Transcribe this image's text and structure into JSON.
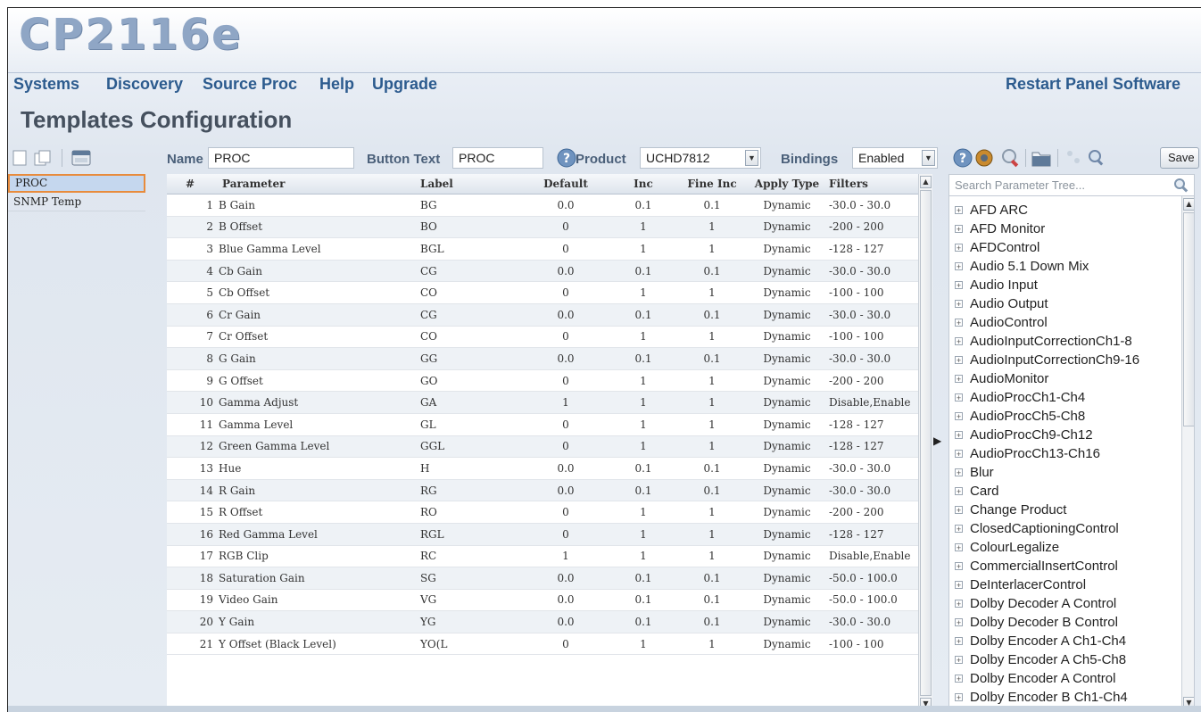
{
  "app": {
    "logo": "CP2116e"
  },
  "nav": {
    "items": [
      "Systems",
      "Discovery",
      "Source Proc",
      "Help",
      "Upgrade"
    ],
    "restart": "Restart Panel Software"
  },
  "page": {
    "title": "Templates Configuration"
  },
  "form": {
    "name_label": "Name",
    "name_value": "PROC",
    "button_text_label": "Button Text",
    "button_text_value": "PROC",
    "product_label": "Product",
    "product_value": "UCHD7812",
    "bindings_label": "Bindings",
    "bindings_value": "Enabled"
  },
  "templates": [
    "PROC",
    "SNMP Temp"
  ],
  "table": {
    "headers": [
      "#",
      "Parameter",
      "Label",
      "Default",
      "Inc",
      "Fine Inc",
      "Apply Type",
      "Filters"
    ],
    "rows": [
      [
        "1",
        "B Gain",
        "BG",
        "0.0",
        "0.1",
        "0.1",
        "Dynamic",
        "-30.0 - 30.0"
      ],
      [
        "2",
        "B Offset",
        "BO",
        "0",
        "1",
        "1",
        "Dynamic",
        "-200 - 200"
      ],
      [
        "3",
        "Blue Gamma Level",
        "BGL",
        "0",
        "1",
        "1",
        "Dynamic",
        "-128 - 127"
      ],
      [
        "4",
        "Cb Gain",
        "CG",
        "0.0",
        "0.1",
        "0.1",
        "Dynamic",
        "-30.0 - 30.0"
      ],
      [
        "5",
        "Cb Offset",
        "CO",
        "0",
        "1",
        "1",
        "Dynamic",
        "-100 - 100"
      ],
      [
        "6",
        "Cr Gain",
        "CG",
        "0.0",
        "0.1",
        "0.1",
        "Dynamic",
        "-30.0 - 30.0"
      ],
      [
        "7",
        "Cr Offset",
        "CO",
        "0",
        "1",
        "1",
        "Dynamic",
        "-100 - 100"
      ],
      [
        "8",
        "G Gain",
        "GG",
        "0.0",
        "0.1",
        "0.1",
        "Dynamic",
        "-30.0 - 30.0"
      ],
      [
        "9",
        "G Offset",
        "GO",
        "0",
        "1",
        "1",
        "Dynamic",
        "-200 - 200"
      ],
      [
        "10",
        "Gamma Adjust",
        "GA",
        "1",
        "1",
        "1",
        "Dynamic",
        "Disable,Enable"
      ],
      [
        "11",
        "Gamma Level",
        "GL",
        "0",
        "1",
        "1",
        "Dynamic",
        "-128 - 127"
      ],
      [
        "12",
        "Green Gamma Level",
        "GGL",
        "0",
        "1",
        "1",
        "Dynamic",
        "-128 - 127"
      ],
      [
        "13",
        "Hue",
        "H",
        "0.0",
        "0.1",
        "0.1",
        "Dynamic",
        "-30.0 - 30.0"
      ],
      [
        "14",
        "R Gain",
        "RG",
        "0.0",
        "0.1",
        "0.1",
        "Dynamic",
        "-30.0 - 30.0"
      ],
      [
        "15",
        "R Offset",
        "RO",
        "0",
        "1",
        "1",
        "Dynamic",
        "-200 - 200"
      ],
      [
        "16",
        "Red Gamma Level",
        "RGL",
        "0",
        "1",
        "1",
        "Dynamic",
        "-128 - 127"
      ],
      [
        "17",
        "RGB Clip",
        "RC",
        "1",
        "1",
        "1",
        "Dynamic",
        "Disable,Enable"
      ],
      [
        "18",
        "Saturation Gain",
        "SG",
        "0.0",
        "0.1",
        "0.1",
        "Dynamic",
        "-50.0 - 100.0"
      ],
      [
        "19",
        "Video Gain",
        "VG",
        "0.0",
        "0.1",
        "0.1",
        "Dynamic",
        "-50.0 - 100.0"
      ],
      [
        "20",
        "Y Gain",
        "YG",
        "0.0",
        "0.1",
        "0.1",
        "Dynamic",
        "-30.0 - 30.0"
      ],
      [
        "21",
        "Y Offset (Black Level)",
        "YO(L",
        "0",
        "1",
        "1",
        "Dynamic",
        "-100 - 100"
      ]
    ]
  },
  "tree": {
    "search_placeholder": "Search Parameter Tree...",
    "items": [
      "AFD ARC",
      "AFD Monitor",
      "AFDControl",
      "Audio 5.1 Down Mix",
      "Audio Input",
      "Audio Output",
      "AudioControl",
      "AudioInputCorrectionCh1-8",
      "AudioInputCorrectionCh9-16",
      "AudioMonitor",
      "AudioProcCh1-Ch4",
      "AudioProcCh5-Ch8",
      "AudioProcCh9-Ch12",
      "AudioProcCh13-Ch16",
      "Blur",
      "Card",
      "Change Product",
      "ClosedCaptioningControl",
      "ColourLegalize",
      "CommercialInsertControl",
      "DeInterlacerControl",
      "Dolby Decoder A Control",
      "Dolby Decoder B Control",
      "Dolby Encoder A Ch1-Ch4",
      "Dolby Encoder A Ch5-Ch8",
      "Dolby Encoder A Control",
      "Dolby Encoder B Ch1-Ch4"
    ]
  },
  "toolbar": {
    "save_label": "Save"
  },
  "colors": {
    "nav": "#2c5b8e",
    "selected_border": "#e88b3c",
    "selected_bg": "#c5d7ee"
  }
}
